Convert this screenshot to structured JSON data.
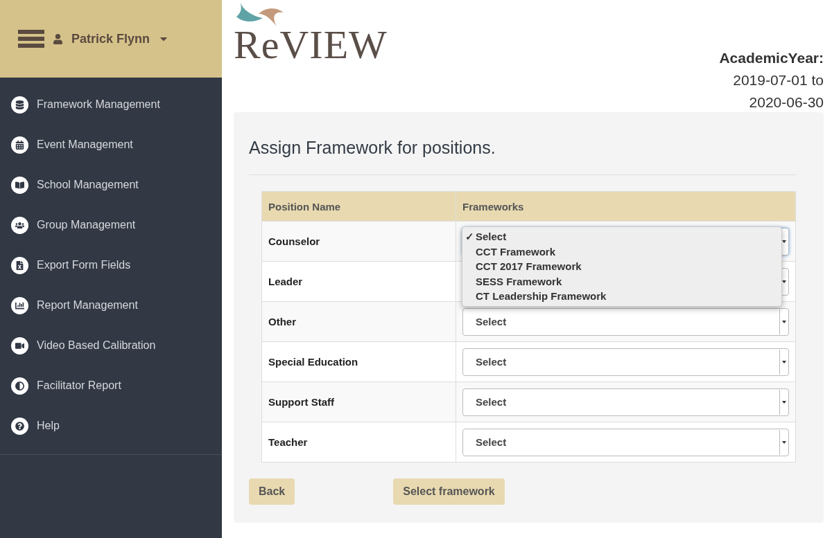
{
  "user": {
    "name": "Patrick Flynn"
  },
  "sidebar": {
    "items": [
      {
        "label": "Framework Management"
      },
      {
        "label": "Event Management"
      },
      {
        "label": "School Management"
      },
      {
        "label": "Group Management"
      },
      {
        "label": "Export Form Fields"
      },
      {
        "label": "Report Management"
      },
      {
        "label": "Video Based Calibration"
      },
      {
        "label": "Facilitator Report"
      },
      {
        "label": "Help"
      }
    ]
  },
  "logo": {
    "text": "ReVIEW"
  },
  "academic_year": {
    "label": "AcademicYear:",
    "line_1": "2019-07-01 to",
    "line_2": "2020-06-30"
  },
  "title": "Assign Framework for positions.",
  "table": {
    "columns": [
      "Position Name",
      "Frameworks"
    ],
    "rows": [
      {
        "position": "Counselor",
        "open": true
      },
      {
        "position": "Leader",
        "open": false
      },
      {
        "position": "Other",
        "open": false,
        "value": "Select"
      },
      {
        "position": "Special Education",
        "open": false,
        "value": "Select"
      },
      {
        "position": "Support Staff",
        "open": false,
        "value": "Select"
      },
      {
        "position": "Teacher",
        "open": false,
        "value": "Select"
      }
    ]
  },
  "open_menu": {
    "check": "✓",
    "options": [
      {
        "label": "Select",
        "selected": true
      },
      {
        "label": "CCT Framework",
        "selected": false
      },
      {
        "label": "CCT 2017 Framework",
        "selected": false
      },
      {
        "label": "SESS Framework",
        "selected": false
      },
      {
        "label": "CT Leadership Framework",
        "selected": false
      }
    ]
  },
  "buttons": [
    "Back",
    "Select framework"
  ]
}
